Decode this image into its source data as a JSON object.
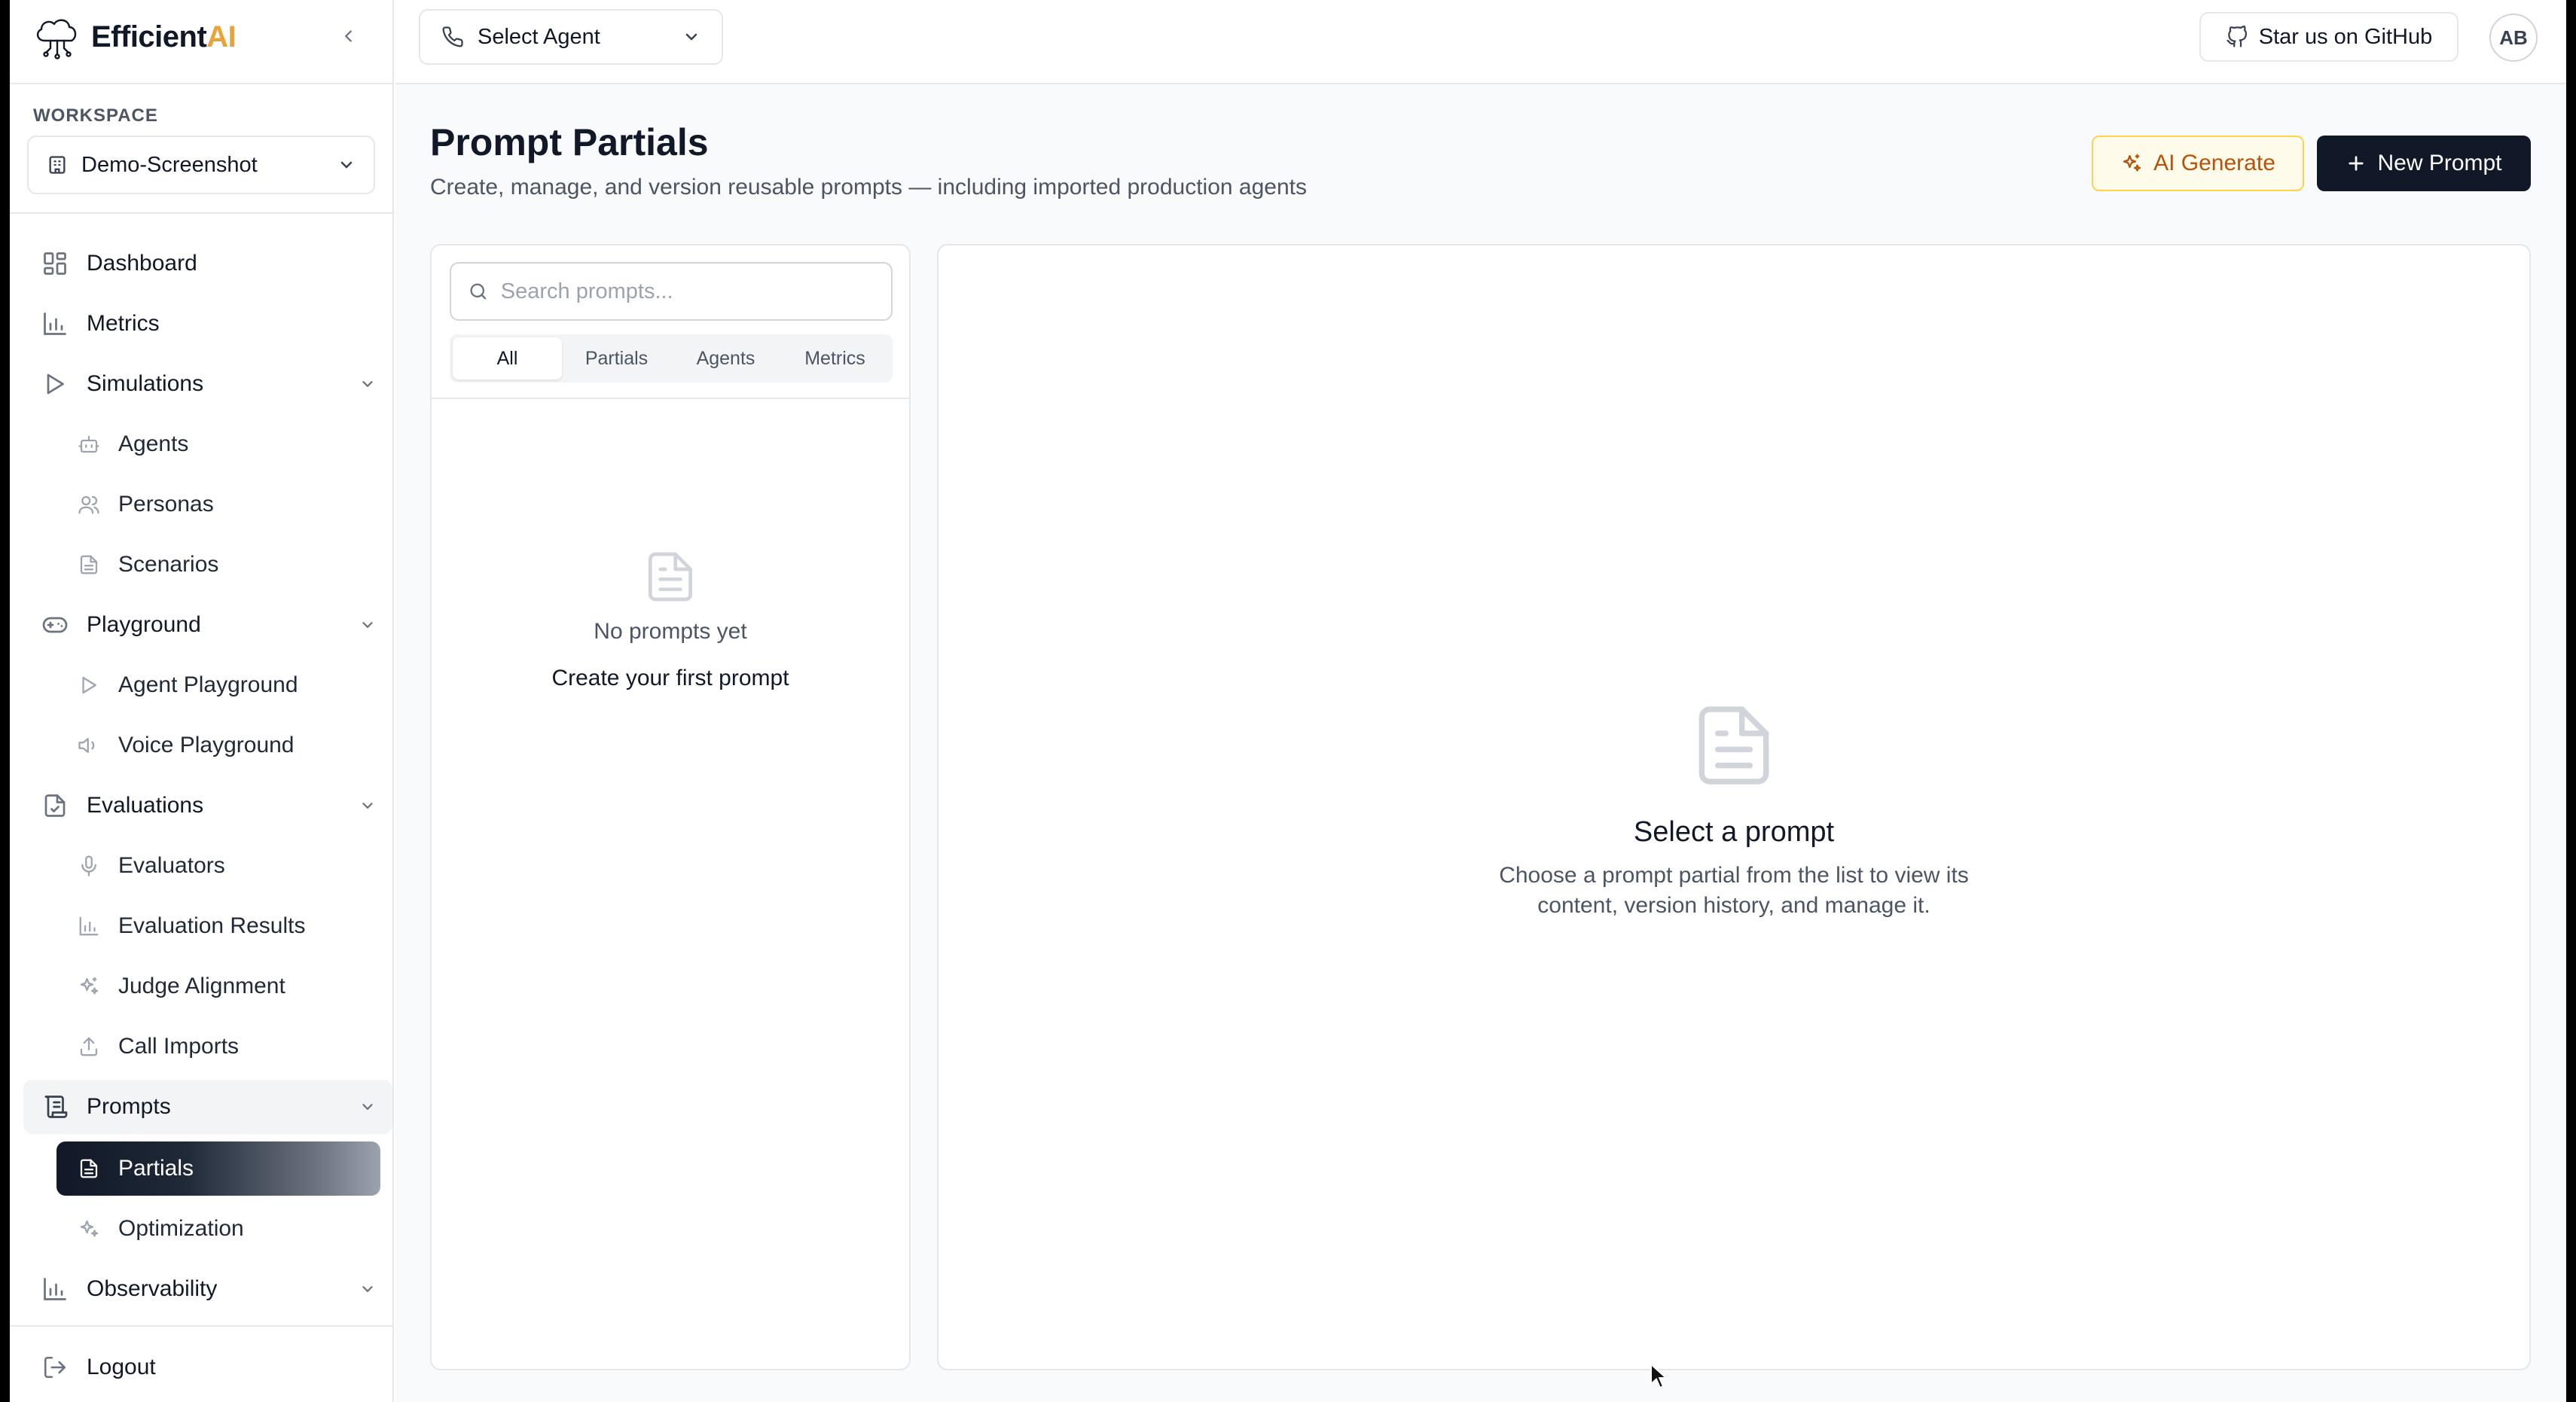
{
  "brand": {
    "name_main": "Efficient",
    "name_accent": "AI"
  },
  "workspace": {
    "label": "WORKSPACE",
    "selected": "Demo-Screenshot"
  },
  "sidebar": {
    "items": [
      {
        "label": "Dashboard",
        "icon": "dashboard-icon"
      },
      {
        "label": "Metrics",
        "icon": "bar-chart-icon"
      },
      {
        "label": "Simulations",
        "icon": "play-icon",
        "expanded": true
      },
      {
        "label": "Agents",
        "icon": "bot-icon"
      },
      {
        "label": "Personas",
        "icon": "users-icon"
      },
      {
        "label": "Scenarios",
        "icon": "document-icon"
      },
      {
        "label": "Playground",
        "icon": "gamepad-icon",
        "expanded": true
      },
      {
        "label": "Agent Playground",
        "icon": "play-icon"
      },
      {
        "label": "Voice Playground",
        "icon": "speaker-icon"
      },
      {
        "label": "Evaluations",
        "icon": "clipboard-check-icon",
        "expanded": true
      },
      {
        "label": "Evaluators",
        "icon": "microphone-icon"
      },
      {
        "label": "Evaluation Results",
        "icon": "bar-chart-icon"
      },
      {
        "label": "Judge Alignment",
        "icon": "sparkles-icon"
      },
      {
        "label": "Call Imports",
        "icon": "upload-icon"
      },
      {
        "label": "Prompts",
        "icon": "scroll-icon",
        "expanded": true
      },
      {
        "label": "Partials",
        "icon": "document-icon",
        "active": true
      },
      {
        "label": "Optimization",
        "icon": "sparkles-icon"
      },
      {
        "label": "Observability",
        "icon": "bar-chart-icon"
      }
    ],
    "logout": "Logout"
  },
  "topbar": {
    "agent_select": "Select Agent",
    "github": "Star us on GitHub",
    "avatar": "AB"
  },
  "page": {
    "title": "Prompt Partials",
    "subtitle": "Create, manage, and version reusable prompts — including imported production agents",
    "ai_generate": "AI Generate",
    "new_prompt": "New Prompt"
  },
  "list": {
    "search_placeholder": "Search prompts...",
    "tabs": [
      "All",
      "Partials",
      "Agents",
      "Metrics"
    ],
    "active_tab": "All",
    "empty_title": "No prompts yet",
    "empty_action": "Create your first prompt"
  },
  "detail": {
    "title": "Select a prompt",
    "description": "Choose a prompt partial from the list to view its content, version history, and manage it."
  },
  "colors": {
    "accent": "#e8a33a",
    "primary": "#111827",
    "ai_button_bg": "#fffbeb",
    "ai_button_text": "#b45309"
  }
}
